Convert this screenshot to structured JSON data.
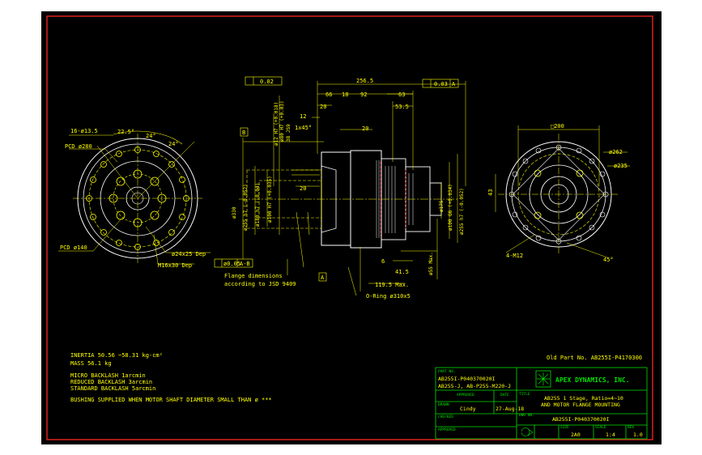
{
  "notes": {
    "inertia": "INERTIA   50.56 ~58.31 kg-cm²",
    "mass": "MASS   56.1 kg",
    "micro": "MICRO BACKLASH 1arcmin",
    "reduced": "REDUCED BACKLASH 3arcmin",
    "standard": "STANDARD BACKLASH 5arcmin",
    "bushing": "BUSHING SUPPLIED WHEN MOTOR SHAFT DIAMETER SMALL THAN ø ***",
    "old_part": "Old Part No. AB255I-P4170300"
  },
  "title_block": {
    "part_label": "PART NO.",
    "part_no_1": "AB255I-P040370020I",
    "part_no_2": "AB255-J, AB-P255-M220-J",
    "approved_label": "APPROVED",
    "date_label": "DATE",
    "drawn_label": "DRAWN",
    "drawn_by": "Cindy",
    "drawn_date": "27-Aug-18",
    "checked_label": "CHECKED",
    "approved2_label": "APPROVED",
    "company": "APEX DYNAMICS, INC.",
    "title_label": "TITLE",
    "title_1": "AB255 1 Stage, Ratio=4~10",
    "title_2": "AND MOTOR FLANGE MOUNTING",
    "dwg_label": "DWG NO.",
    "dwg_no": "AB255I-P040370020I",
    "size_label": "SIZE",
    "size": "2A0",
    "scale_label": "SCALE",
    "scale": "1:4",
    "rev_label": "REV",
    "rev": "1.0"
  },
  "left_view": {
    "holes": "16-ø13.5",
    "angle_1": "22.5°",
    "angle_2": "24°",
    "angle_3": "24°",
    "pcd_280": "PCD ø280",
    "pcd_140": "PCD ø140",
    "tap_1": "ø24x25 Dep",
    "tap_2": "M16x30 Dep"
  },
  "side_view": {
    "d_256_5": "256.5",
    "d_66": "66",
    "d_18": "18",
    "d_92": "92",
    "d_63": "63",
    "d_53_5": "53.5",
    "d_12": "12",
    "d_1x45": "1x45°",
    "d_20a": "20",
    "d_20b": "20",
    "d_20c": "20",
    "runout_flatness": "0.02",
    "perp": "0.03",
    "datum_a": "A",
    "datum_b": "B",
    "d_80": "ø80 H7 (+0.03)",
    "d_330": "ø330",
    "d_255a": "ø255 h7 (-0.052)",
    "d_180": "ø180 h7 (-0.04)",
    "d_100": "ø100 H7 (+0.035)",
    "d_12h": "ø12 H7 (+0.018)",
    "d_38": "38 JS9",
    "d_175": "ø175",
    "d_100b": "ø100 G6 (+0.034)",
    "d_255b": "ø255 h7 (-0.052)",
    "d_55": "ø55 Max.",
    "d_6": "6",
    "d_41_5": "41.5",
    "d_119_5": "119.5 Max.",
    "pos": "ø0.05",
    "pos_ref": "A-B",
    "note_1": "Flange dimensions",
    "note_2": "according to JSD 9409",
    "oring": "O-Ring ø310x5"
  },
  "right_view": {
    "sq": "□200",
    "d_262": "ø262",
    "d_235": "ø235",
    "d_43": "43",
    "m12": "4-M12",
    "a45": "45°"
  }
}
